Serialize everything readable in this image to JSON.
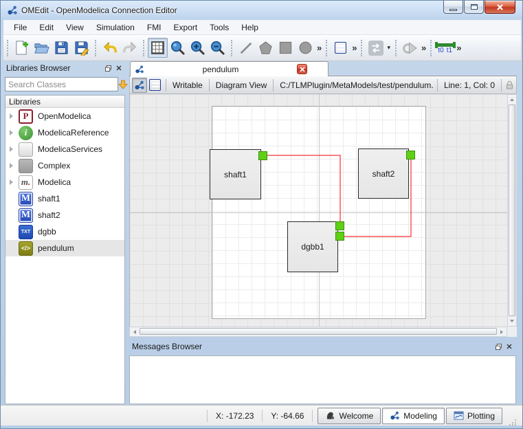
{
  "window": {
    "title": "OMEdit - OpenModelica Connection Editor"
  },
  "menubar": {
    "items": [
      "File",
      "Edit",
      "View",
      "Simulation",
      "FMI",
      "Export",
      "Tools",
      "Help"
    ]
  },
  "toolbar": {
    "overflow": "»",
    "dropdown_caret": "▾",
    "tlm_t0": "t0",
    "tlm_t1": "t1"
  },
  "libraries": {
    "title": "Libraries Browser",
    "search_placeholder": "Search Classes",
    "header": "Libraries",
    "items": [
      {
        "label": "OpenModelica",
        "icon": "openmodelica-icon",
        "expandable": true
      },
      {
        "label": "ModelicaReference",
        "icon": "info-icon",
        "expandable": true
      },
      {
        "label": "ModelicaServices",
        "icon": "plain-icon",
        "expandable": true
      },
      {
        "label": "Complex",
        "icon": "gray-icon",
        "expandable": true
      },
      {
        "label": "Modelica",
        "icon": "modelica-icon",
        "expandable": true
      },
      {
        "label": "shaft1",
        "icon": "model-icon",
        "expandable": false
      },
      {
        "label": "shaft2",
        "icon": "model-icon",
        "expandable": false
      },
      {
        "label": "dgbb",
        "icon": "text-icon",
        "expandable": false
      },
      {
        "label": "pendulum",
        "icon": "code-icon",
        "expandable": false,
        "selected": true
      }
    ]
  },
  "icon_glyphs": {
    "openmodelica": "P",
    "info": "i",
    "modelica": "m",
    "modelica_dot": ".",
    "model": "M",
    "text": "TXT",
    "code": "</>"
  },
  "editor": {
    "tab_label": "pendulum",
    "toolbar": {
      "writable": "Writable",
      "view_mode": "Diagram View",
      "file_path": "C:/TLMPlugin/MetaModels/test/pendulum.xml",
      "cursor_position": "Line: 1, Col: 0"
    },
    "components": [
      {
        "name": "shaft1"
      },
      {
        "name": "shaft2"
      },
      {
        "name": "dgbb1"
      }
    ]
  },
  "messages": {
    "title": "Messages Browser"
  },
  "statusbar": {
    "x_coordinate": "X: -172.23",
    "y_coordinate": "Y: -64.66",
    "perspectives": [
      {
        "label": "Welcome",
        "active": false
      },
      {
        "label": "Modeling",
        "active": true
      },
      {
        "label": "Plotting",
        "active": false
      }
    ]
  },
  "colors": {
    "connection_line": "#ff0000",
    "connector_fill": "#5ed015",
    "component_fill": "#ececec",
    "close_button": "#c03222",
    "tlm_green": "#2e8b2e",
    "search_arrow": "#f6b73c"
  }
}
